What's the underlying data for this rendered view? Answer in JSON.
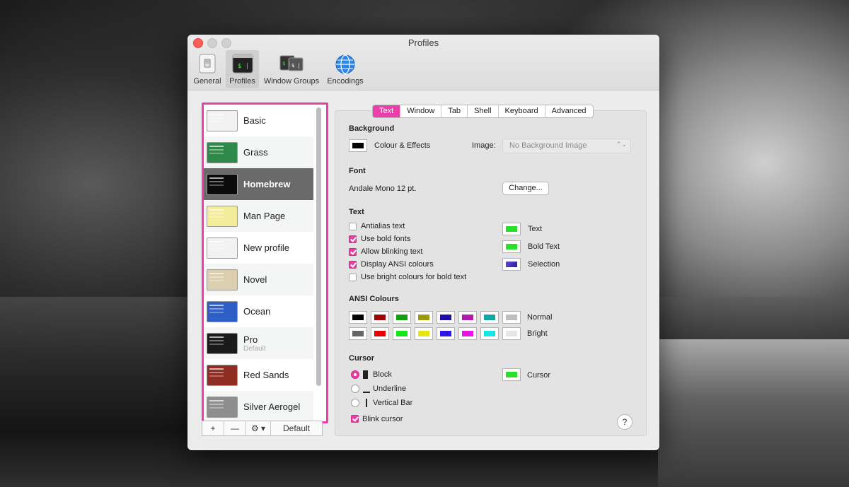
{
  "window": {
    "title": "Profiles"
  },
  "toolbar": {
    "general": "General",
    "profiles": "Profiles",
    "window_groups": "Window Groups",
    "encodings": "Encodings"
  },
  "profiles": [
    {
      "name": "Basic",
      "thumb": "#f2f2f2"
    },
    {
      "name": "Grass",
      "thumb": "#2f8a4a"
    },
    {
      "name": "Homebrew",
      "thumb": "#0b0b0b"
    },
    {
      "name": "Man Page",
      "thumb": "#f3ec9a"
    },
    {
      "name": "New profile",
      "thumb": "#f2f2f2"
    },
    {
      "name": "Novel",
      "thumb": "#dccfb0"
    },
    {
      "name": "Ocean",
      "thumb": "#2d5fc7"
    },
    {
      "name": "Pro",
      "sub": "Default",
      "thumb": "#1a1a1a"
    },
    {
      "name": "Red Sands",
      "thumb": "#8f2d22"
    },
    {
      "name": "Silver Aerogel",
      "thumb": "#8e8e8e"
    }
  ],
  "list_buttons": {
    "add": "+",
    "remove": "—",
    "gear": "⚙ ▾",
    "default": "Default"
  },
  "tabs": [
    "Text",
    "Window",
    "Tab",
    "Shell",
    "Keyboard",
    "Advanced"
  ],
  "background": {
    "header": "Background",
    "colour_effects": "Colour & Effects",
    "image_label": "Image:",
    "image_value": "No Background Image"
  },
  "font": {
    "header": "Font",
    "value": "Andale Mono 12 pt.",
    "change": "Change..."
  },
  "text": {
    "header": "Text",
    "options": [
      {
        "label": "Antialias text",
        "checked": false
      },
      {
        "label": "Use bold fonts",
        "checked": true
      },
      {
        "label": "Allow blinking text",
        "checked": true
      },
      {
        "label": "Display ANSI colours",
        "checked": true
      },
      {
        "label": "Use bright colours for bold text",
        "checked": false
      }
    ],
    "colors": [
      {
        "label": "Text",
        "color": "#28e028"
      },
      {
        "label": "Bold Text",
        "color": "#28e028"
      },
      {
        "label": "Selection",
        "color": "#3a2fae"
      }
    ]
  },
  "ansi": {
    "header": "ANSI Colours",
    "normal_label": "Normal",
    "bright_label": "Bright",
    "normal": [
      "#000000",
      "#a30000",
      "#16a016",
      "#9a9a10",
      "#1a0fa8",
      "#b01ab0",
      "#14a6a6",
      "#bfbfbf"
    ],
    "bright": [
      "#666666",
      "#e60000",
      "#15e615",
      "#e6e615",
      "#2d16e6",
      "#e615e6",
      "#15e6e6",
      "#e6e6e6"
    ]
  },
  "cursor": {
    "header": "Cursor",
    "block": "Block",
    "underline": "Underline",
    "vertical_bar": "Vertical Bar",
    "blink": "Blink cursor",
    "color_label": "Cursor",
    "color": "#28e028"
  },
  "help": "?"
}
